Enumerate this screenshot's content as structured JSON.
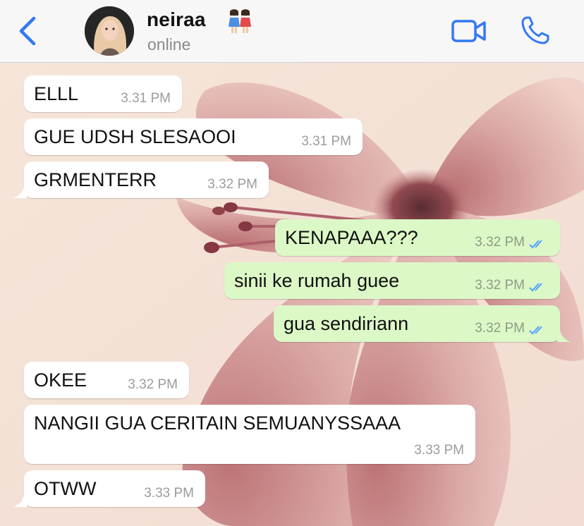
{
  "header": {
    "back_icon": "chevron-left-icon",
    "contact_name": "neiraa",
    "contact_emoji": "two-women-emoji",
    "status": "online",
    "video_icon": "video-camera-icon",
    "call_icon": "phone-icon",
    "accent_color": "#3478f6"
  },
  "colors": {
    "incoming_bubble": "#ffffff",
    "outgoing_bubble": "#dcf8c6",
    "read_ticks": "#4fa3ff"
  },
  "messages": [
    {
      "text": "ELLL",
      "time": "3.31 PM",
      "direction": "incoming"
    },
    {
      "text": "GUE UDSH SLESAOOI",
      "time": "3.31 PM",
      "direction": "incoming"
    },
    {
      "text": "GRMENTERR",
      "time": "3.32 PM",
      "direction": "incoming"
    },
    {
      "text": "KENAPAAA???",
      "time": "3.32 PM",
      "direction": "outgoing",
      "status": "read"
    },
    {
      "text": "sinii ke rumah guee",
      "time": "3.32 PM",
      "direction": "outgoing",
      "status": "read"
    },
    {
      "text": "gua sendiriann",
      "time": "3.32 PM",
      "direction": "outgoing",
      "status": "read"
    },
    {
      "text": "OKEE",
      "time": "3.32 PM",
      "direction": "incoming"
    },
    {
      "text": "NANGII GUA CERITAIN SEMUANYSSAAA",
      "time": "3.33 PM",
      "direction": "incoming"
    },
    {
      "text": "OTWW",
      "time": "3.33 PM",
      "direction": "incoming"
    }
  ]
}
